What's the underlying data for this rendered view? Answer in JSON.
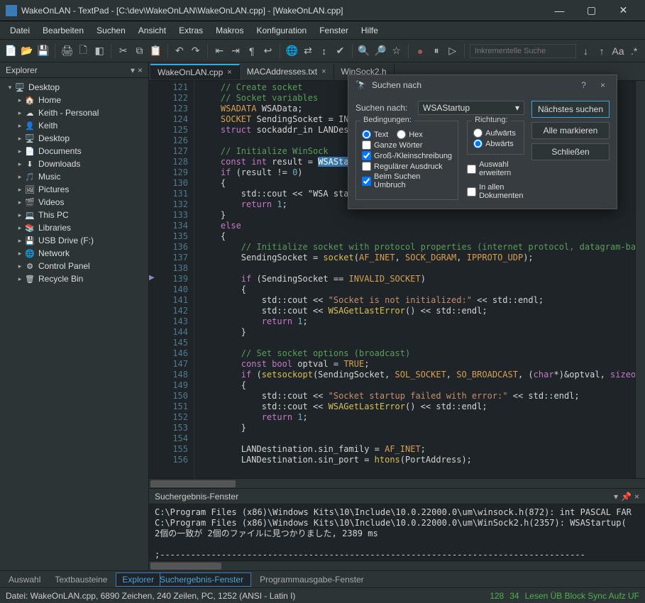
{
  "window": {
    "title": "WakeOnLAN - TextPad - [C:\\dev\\WakeOnLAN\\WakeOnLAN.cpp] - [WakeOnLAN.cpp]",
    "min": "—",
    "max": "▢",
    "close": "✕"
  },
  "menu": [
    "Datei",
    "Bearbeiten",
    "Suchen",
    "Ansicht",
    "Extras",
    "Makros",
    "Konfiguration",
    "Fenster",
    "Hilfe"
  ],
  "toolbar": {
    "search_placeholder": "Inkrementelle Suche",
    "aa": "Aa"
  },
  "explorer": {
    "title": "Explorer",
    "items": [
      {
        "indent": 0,
        "toggle": "▾",
        "icon": "🖥️",
        "label": "Desktop"
      },
      {
        "indent": 1,
        "toggle": "▸",
        "icon": "🏠",
        "label": "Home"
      },
      {
        "indent": 1,
        "toggle": "▸",
        "icon": "☁",
        "label": "Keith - Personal"
      },
      {
        "indent": 1,
        "toggle": "▸",
        "icon": "👤",
        "label": "Keith"
      },
      {
        "indent": 1,
        "toggle": "▸",
        "icon": "🖥️",
        "label": "Desktop"
      },
      {
        "indent": 1,
        "toggle": "▸",
        "icon": "📄",
        "label": "Documents"
      },
      {
        "indent": 1,
        "toggle": "▸",
        "icon": "⬇",
        "label": "Downloads"
      },
      {
        "indent": 1,
        "toggle": "▸",
        "icon": "🎵",
        "label": "Music"
      },
      {
        "indent": 1,
        "toggle": "▸",
        "icon": "🖼",
        "label": "Pictures"
      },
      {
        "indent": 1,
        "toggle": "▸",
        "icon": "🎬",
        "label": "Videos"
      },
      {
        "indent": 1,
        "toggle": "▸",
        "icon": "💻",
        "label": "This PC"
      },
      {
        "indent": 1,
        "toggle": "▸",
        "icon": "📚",
        "label": "Libraries"
      },
      {
        "indent": 1,
        "toggle": "▸",
        "icon": "💾",
        "label": "USB Drive (F:)"
      },
      {
        "indent": 1,
        "toggle": "▸",
        "icon": "🌐",
        "label": "Network"
      },
      {
        "indent": 1,
        "toggle": "▸",
        "icon": "⚙",
        "label": "Control Panel"
      },
      {
        "indent": 1,
        "toggle": "▸",
        "icon": "🗑",
        "label": "Recycle Bin"
      }
    ],
    "tabs": [
      "Auswahl",
      "Textbausteine",
      "Explorer"
    ]
  },
  "tabs": [
    {
      "label": "WakeOnLAN.cpp",
      "active": true,
      "close": "×"
    },
    {
      "label": "MACAddresses.txt",
      "active": false,
      "close": "×"
    },
    {
      "label": "WinSock2.h",
      "active": false,
      "close": ""
    }
  ],
  "gutter_start": 121,
  "gutter_end": 156,
  "code": {
    "lines": [
      "    // Create socket",
      "    // Socket variables",
      "    WSADATA WSAData;",
      "    SOCKET SendingSocket = INVALI",
      "    struct sockaddr_in LANDestina",
      "",
      "    // Initialize WinSock",
      "    const int result = WSAStartup",
      "    if (result != 0)",
      "    {",
      "        std::cout << \"WSA startup",
      "        return 1;",
      "    }",
      "    else",
      "    {",
      "        // Initialize socket with protocol properties (internet protocol, datagram-based p",
      "        SendingSocket = socket(AF_INET, SOCK_DGRAM, IPPROTO_UDP);",
      "",
      "        if (SendingSocket == INVALID_SOCKET)",
      "        {",
      "            std::cout << \"Socket is not initialized:\" << std::endl;",
      "            std::cout << WSAGetLastError() << std::endl;",
      "            return 1;",
      "        }",
      "",
      "        // Set socket options (broadcast)",
      "        const bool optval = TRUE;",
      "        if (setsockopt(SendingSocket, SOL_SOCKET, SO_BROADCAST, (char*)&optval, sizeof(opt",
      "        {",
      "            std::cout << \"Socket startup failed with error:\" << std::endl;",
      "            std::cout << WSAGetLastError() << std::endl;",
      "            return 1;",
      "        }",
      "",
      "        LANDestination.sin_family = AF_INET;",
      "        LANDestination.sin_port = htons(PortAddress);"
    ]
  },
  "results_panel": {
    "title": "Suchergebnis-Fenster",
    "lines": [
      "C:\\Program Files (x86)\\Windows Kits\\10\\Include\\10.0.22000.0\\um\\winsock.h(872): int PASCAL FAR ",
      "C:\\Program Files (x86)\\Windows Kits\\10\\Include\\10.0.22000.0\\um\\WinSock2.h(2357): WSAStartup(",
      "2個の一致が 2個のファイルに見つかりました, 2389 ms",
      "",
      ";-----------------------------------------------------------------------------------",
      ";-----------------------------------------------------------------------------------"
    ],
    "tabs": [
      "Suchergebnis-Fenster",
      "Programmausgabe-Fenster"
    ]
  },
  "status": {
    "file": "Datei: WakeOnLAN.cpp, 6890 Zeichen, 240 Zeilen, PC, 1252  (ANSI - Latin I)",
    "line": "128",
    "col": "34",
    "indicators": "Lesen  ÜB  Block  Sync  Aufz  UF  "
  },
  "dialog": {
    "title": "Suchen nach",
    "search_label": "Suchen nach:",
    "search_value": "WSAStartup",
    "cond_title": "Bedingungen:",
    "opt_text": "Text",
    "opt_hex": "Hex",
    "opt_whole": "Ganze Wörter",
    "opt_case": "Groß-/Kleinschreibung",
    "opt_regex": "Regulärer Ausdruck",
    "opt_wrap": "Beim Suchen Umbruch",
    "dir_title": "Richtung:",
    "opt_up": "Aufwärts",
    "opt_down": "Abwärts",
    "opt_extend": "Auswahl erweitern",
    "opt_alldocs": "In allen Dokumenten",
    "btn_next": "Nächstes suchen",
    "btn_all": "Alle markieren",
    "btn_close": "Schließen"
  }
}
